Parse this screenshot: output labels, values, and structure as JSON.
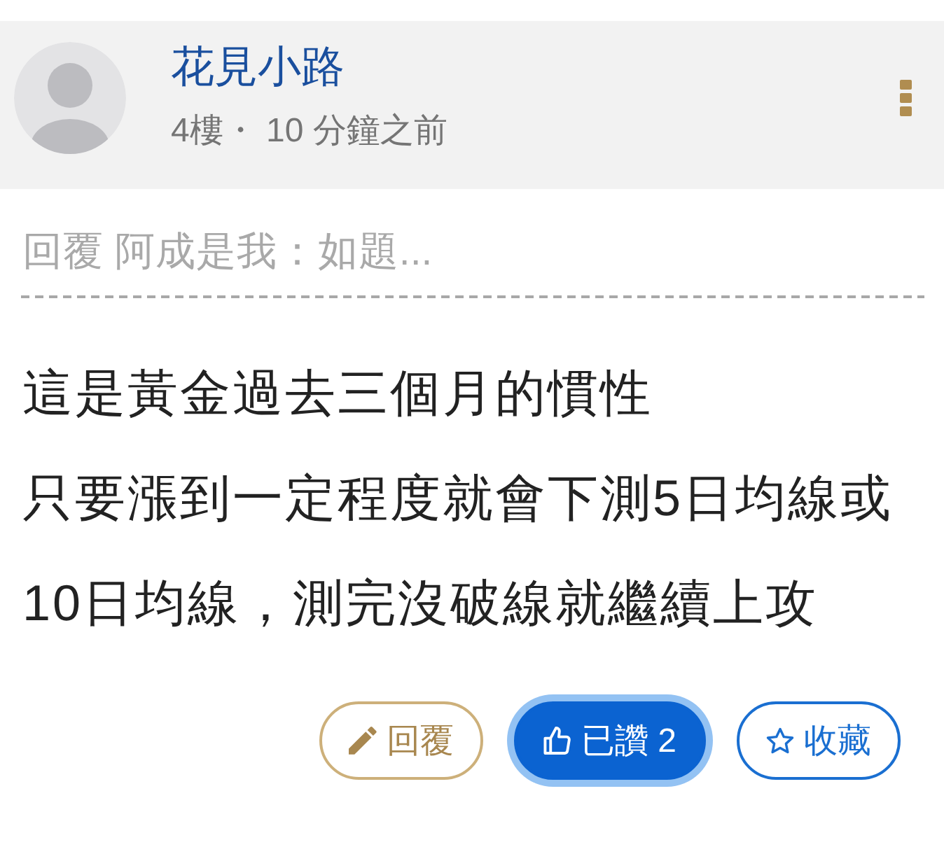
{
  "post": {
    "author": "花見小路",
    "meta": "4樓・ 10 分鐘之前"
  },
  "quote": "回覆 阿成是我：如題...",
  "body": [
    "這是黃金過去三個月的慣性",
    "只要漲到一定程度就會下測5日均線或10日均線，測完沒破線就繼續上攻"
  ],
  "actions": [
    {
      "kind": "reply",
      "label": "回覆",
      "active": false
    },
    {
      "kind": "like",
      "label": "已讚 2",
      "active": true
    },
    {
      "kind": "favorite",
      "label": "收藏",
      "active": false
    }
  ]
}
